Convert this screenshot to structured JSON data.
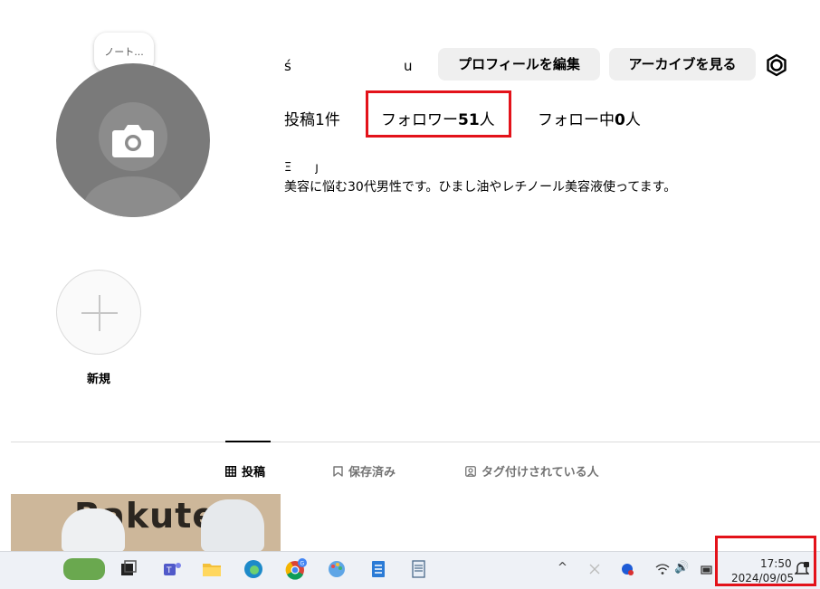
{
  "profile": {
    "note_bubble": "ノート...",
    "username_start": "ś",
    "username_end": "u",
    "name_fragment": "Ξ　　ȷ",
    "bio": "美容に悩む30代男性です。ひまし油やレチノール美容液使ってます。"
  },
  "buttons": {
    "edit_profile": "プロフィールを編集",
    "view_archive": "アーカイブを見る"
  },
  "stats": {
    "posts_label": "投稿",
    "posts_count": "1",
    "posts_unit": "件",
    "followers_label": "フォロワー",
    "followers_count": "51",
    "followers_unit": "人",
    "following_label": "フォロー中",
    "following_count": "0",
    "following_unit": "人"
  },
  "highlights": {
    "new_label": "新規"
  },
  "tabs": [
    {
      "label": "投稿",
      "icon": "grid-icon",
      "active": true
    },
    {
      "label": "保存済み",
      "icon": "bookmark-icon",
      "active": false
    },
    {
      "label": "タグ付けされている人",
      "icon": "tag-person-icon",
      "active": false
    }
  ],
  "thumbnail": {
    "text": "Rakuten"
  },
  "taskbar": {
    "time": "17:50",
    "date": "2024/09/05",
    "icons": [
      "widgets-icon",
      "task-view-icon",
      "teams-icon",
      "file-explorer-icon",
      "edge-icon",
      "chrome-icon",
      "paint-icon",
      "notepad-icon",
      "document-icon"
    ],
    "tray_chevron": "^",
    "tray_speaker": "🔊"
  },
  "colors": {
    "highlight_red": "#e3121a",
    "button_bg": "#efefef",
    "avatar_gray": "#7a7a7a"
  }
}
